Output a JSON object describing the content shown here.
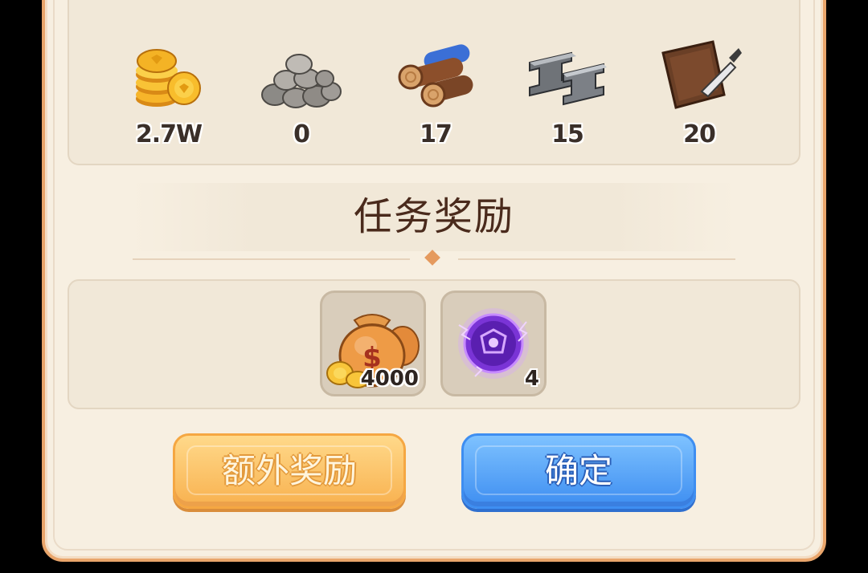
{
  "resources": [
    {
      "icon": "gold-coins-icon",
      "value": "2.7W"
    },
    {
      "icon": "stone-icon",
      "value": "0"
    },
    {
      "icon": "wood-logs-icon",
      "value": "17"
    },
    {
      "icon": "iron-ingot-icon",
      "value": "15"
    },
    {
      "icon": "leather-icon",
      "value": "20"
    }
  ],
  "section_title": "任务奖励",
  "rewards": [
    {
      "icon": "money-bag-icon",
      "count": "4000"
    },
    {
      "icon": "purple-orb-icon",
      "count": "4"
    }
  ],
  "buttons": {
    "extra_label": "额外奖励",
    "confirm_label": "确定"
  },
  "colors": {
    "panel_bg": "#f7efe1",
    "panel_border": "#e9a56b",
    "title": "#4a2a1c",
    "extra_button": "#f8b14f",
    "confirm_button": "#3e8ef1"
  }
}
